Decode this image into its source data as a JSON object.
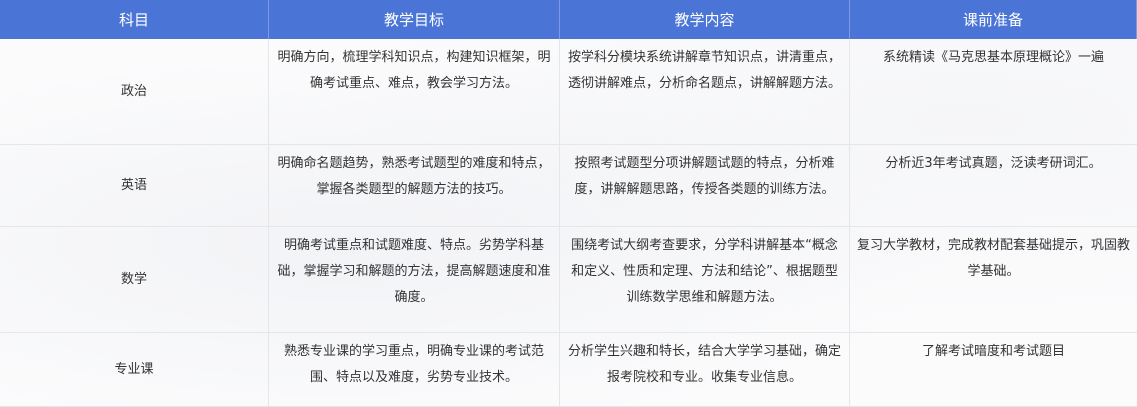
{
  "headers": [
    "科目",
    "教学目标",
    "教学内容",
    "课前准备"
  ],
  "rows": [
    {
      "subject": "政治",
      "goal": "明确方向，梳理学科知识点，构建知识框架，明确考试重点、难点，教会学习方法。",
      "content": "按学科分模块系统讲解章节知识点，讲清重点，透彻讲解难点，分析命名题点，讲解解题方法。",
      "prep": "系统精读《马克思基本原理概论》一遍"
    },
    {
      "subject": "英语",
      "goal": "明确命名题趋势，熟悉考试题型的难度和特点，掌握各类题型的解题方法的技巧。",
      "content": "按照考试题型分项讲解题试题的特点，分析难度，讲解解题思路，传授各类题的训练方法。",
      "prep": "分析近3年考试真题，泛读考研词汇。"
    },
    {
      "subject": "数学",
      "goal": "明确考试重点和试题难度、特点。劣势学科基础，掌握学习和解题的方法，提高解题速度和准确度。",
      "content": "围绕考试大纲考查要求，分学科讲解基本“概念和定义、性质和定理、方法和结论”、根据题型训练数学思维和解题方法。",
      "prep": "复习大学教材，完成教材配套基础提示，巩固教学基础。"
    },
    {
      "subject": "专业课",
      "goal": "熟悉专业课的学习重点，明确专业课的考试范围、特点以及难度，劣势专业技术。",
      "content": "分析学生兴趣和特长，结合大学学习基础，确定报考院校和专业。收集专业信息。",
      "prep": "了解考试暗度和考试题目"
    }
  ]
}
